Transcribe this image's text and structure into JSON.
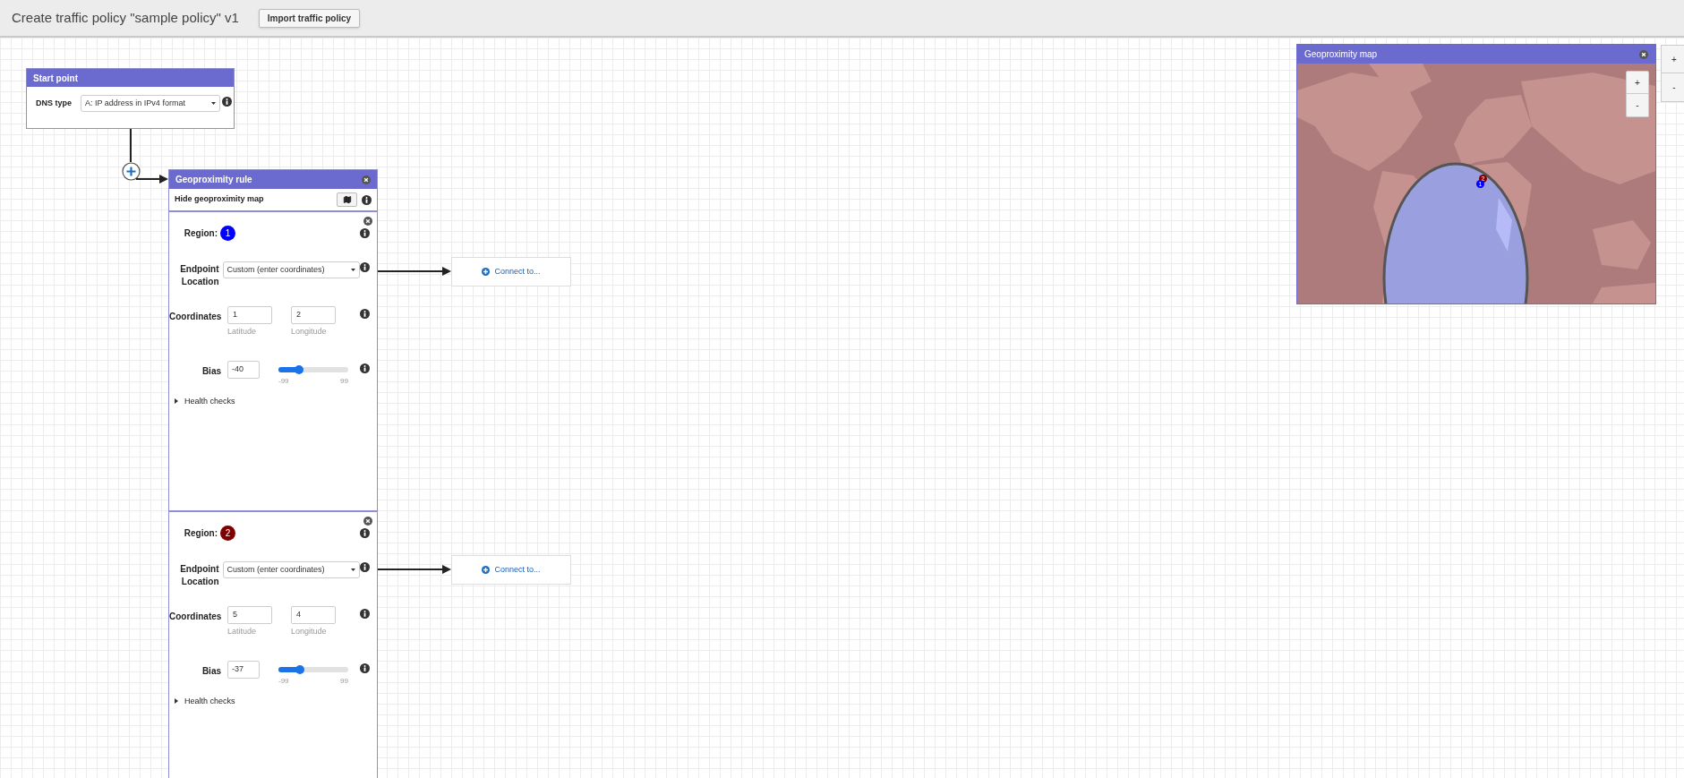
{
  "header": {
    "title": "Create traffic policy \"sample policy\" v1",
    "import_button": "Import traffic policy"
  },
  "start_point": {
    "title": "Start point",
    "dns_type_label": "DNS type",
    "dns_type_value": "A: IP address in IPv4 format"
  },
  "geoproximity_rule": {
    "title": "Geoproximity rule",
    "map_toggle_label": "Hide geoproximity map",
    "regions": [
      {
        "label": "Region:",
        "number": "1",
        "color": "#0000ff",
        "endpoint_label": "Endpoint Location",
        "endpoint_value": "Custom (enter coordinates)",
        "coordinates_label": "Coordinates",
        "latitude": "1",
        "latitude_hint": "Latitude",
        "longitude": "2",
        "longitude_hint": "Longitude",
        "bias_label": "Bias",
        "bias": "-40",
        "level": 0.3,
        "min": "-99",
        "max": "99",
        "health_checks": "Health checks",
        "expanded": false,
        "connect": "Connect to..."
      },
      {
        "label": "Region:",
        "number": "2",
        "color": "#7f0000",
        "endpoint_label": "Endpoint Location",
        "endpoint_value": "Custom (enter coordinates)",
        "coordinates_label": "Coordinates",
        "latitude": "5",
        "latitude_hint": "Latitude",
        "longitude": "4",
        "longitude_hint": "Longitude",
        "bias_label": "Bias",
        "bias": "-37",
        "level": 0.31,
        "min": "-99",
        "max": "99",
        "health_checks": "Health checks",
        "expanded": false,
        "connect": "Connect to..."
      }
    ]
  },
  "geoproximity_map": {
    "title": "Geoproximity map",
    "zoom_in": "+",
    "zoom_out": "-",
    "markers": [
      {
        "number": "2",
        "color": "#7f0000"
      },
      {
        "number": "1",
        "color": "#0000ff"
      }
    ]
  },
  "canvas_zoom": {
    "zoom_in": "+",
    "zoom_out": "-"
  }
}
